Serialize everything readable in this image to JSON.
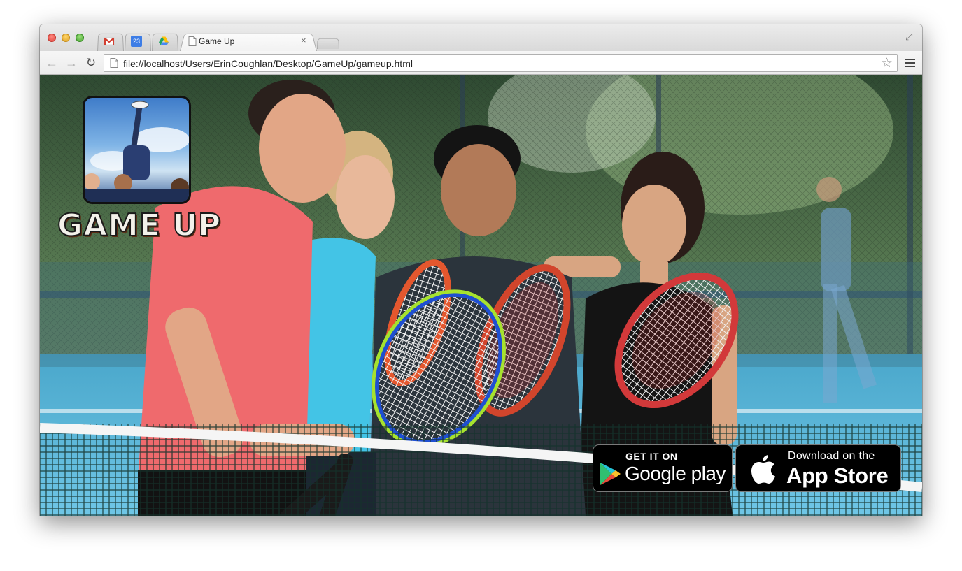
{
  "browser": {
    "tabs": [
      {
        "label": "",
        "icon": "gmail-icon"
      },
      {
        "label": "23",
        "icon": "calendar-icon"
      },
      {
        "label": "",
        "icon": "drive-icon"
      },
      {
        "label": "Game Up",
        "icon": "page-icon",
        "active": true
      }
    ],
    "close_glyph": "×",
    "url": "file://localhost/Users/ErinCoughlan/Desktop/GameUp/gameup.html",
    "star_glyph": "☆",
    "back_glyph": "←",
    "forward_glyph": "→",
    "reload_glyph": "↻",
    "fullscreen_glyph": "⤢"
  },
  "page": {
    "logo_text": "GAME UP",
    "google_play": {
      "small": "GET IT ON",
      "big": "Google play"
    },
    "app_store": {
      "small": "Download on the",
      "big": "App Store"
    }
  },
  "colors": {
    "court_blue": "#57b6d8",
    "shirt_coral": "#ef6a6d",
    "top_cyan": "#43c4e6"
  }
}
